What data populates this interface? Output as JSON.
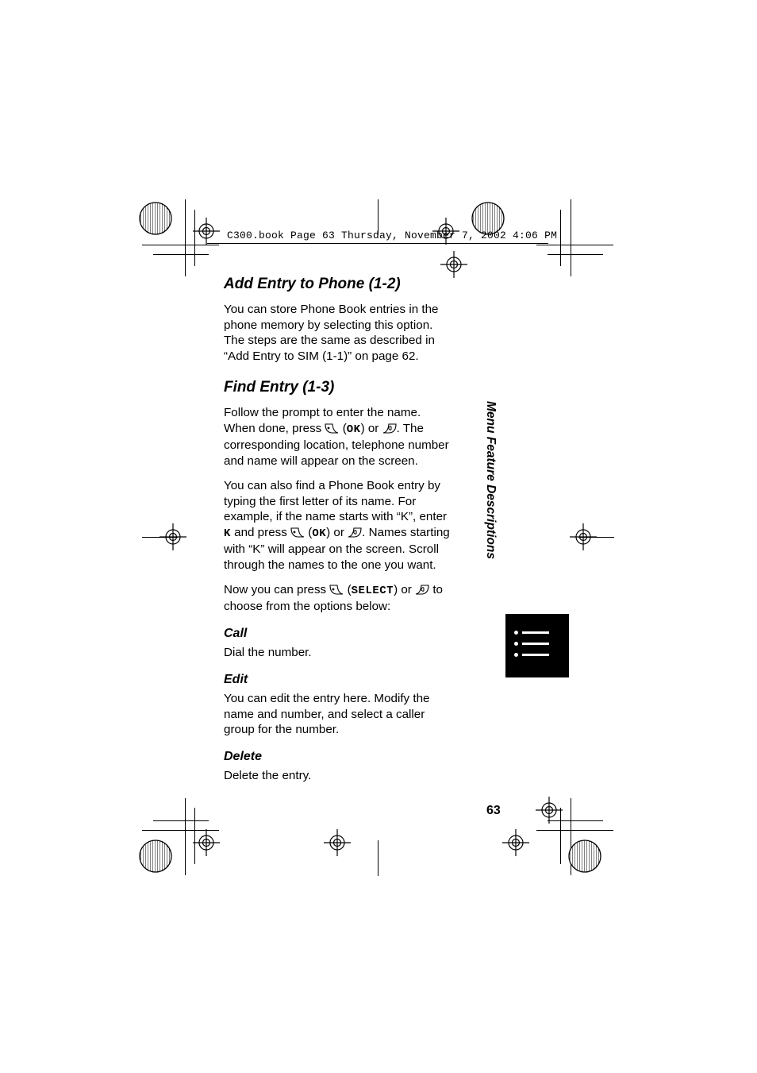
{
  "header_line": "C300.book  Page 63  Thursday, November 7, 2002  4:06 PM",
  "sections": {
    "add_entry": {
      "title": "Add Entry to Phone (1-2)",
      "body": "You can store Phone Book entries in the phone memory by selecting this option. The steps are the same as described in “Add Entry to SIM (1-1)” on page 62."
    },
    "find_entry": {
      "title": "Find Entry (1-3)",
      "p1a": "Follow the prompt to enter the name. When done, press ",
      "p1b": " (",
      "ok1": "OK",
      "p1c": ") or ",
      "p1d": ". The corresponding location, telephone number and name will appear on the screen.",
      "p2a": "You can also find a Phone Book entry by typing the first letter of its name. For example, if the name starts with “K”, enter ",
      "p2_key": "K",
      "p2b": " and press ",
      "p2c": " (",
      "ok2": "OK",
      "p2d": ") or ",
      "p2e": ". Names starting with “K” will appear on the screen. Scroll through the names to the one you want.",
      "p3a": "Now you can press ",
      "p3b": " (",
      "select": "SELECT",
      "p3c": ") or ",
      "p3d": " to choose from the options below:"
    },
    "call": {
      "title": "Call",
      "body": "Dial the number."
    },
    "edit": {
      "title": "Edit",
      "body": "You can edit the entry here. Modify the name and number, and select a caller group for the number."
    },
    "delete": {
      "title": "Delete",
      "body": "Delete the entry."
    }
  },
  "side_label": "Menu Feature Descriptions",
  "page_number": "63"
}
